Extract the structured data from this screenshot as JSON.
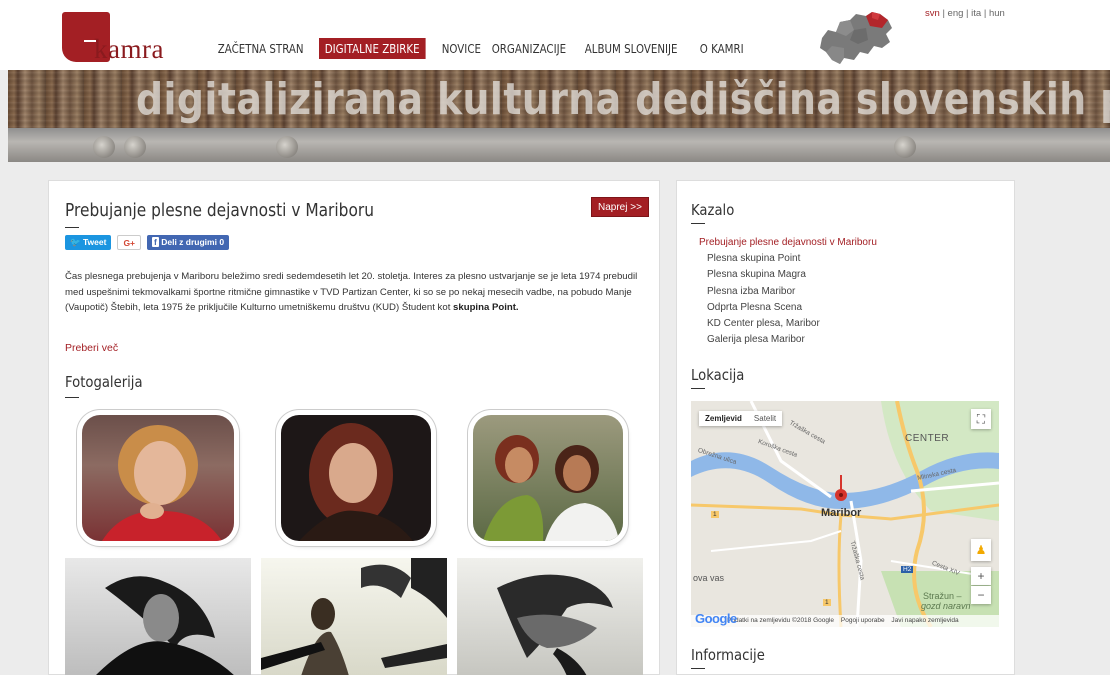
{
  "header": {
    "logo_text": "kamra",
    "nav": [
      {
        "label": "ZAČETNA STRAN",
        "active": false
      },
      {
        "label": "DIGITALNE ZBIRKE",
        "active": true
      },
      {
        "label": "NOVICE",
        "active": false
      },
      {
        "label": "ORGANIZACIJE",
        "active": false
      },
      {
        "label": "ALBUM SLOVENIJE",
        "active": false
      },
      {
        "label": "O KAMRI",
        "active": false
      }
    ],
    "languages": [
      "svn",
      "eng",
      "ita",
      "hun"
    ],
    "language_separator": "|",
    "selected_language": "svn"
  },
  "banner": {
    "title": "digitalizirana kulturna dediščina slovenskih pokrajin"
  },
  "article": {
    "title": "Prebujanje plesne dejavnosti v Mariboru",
    "next_label": "Naprej >>",
    "share": {
      "tweet": "Tweet",
      "gplus": "G+",
      "facebook": "Deli z drugimi",
      "facebook_count": "0"
    },
    "intro_text": "Čas plesnega prebujenja v Mariboru beležimo sredi sedemdesetih let 20. stoletja. Interes za plesno ustvarjanje se je leta 1974 prebudil med uspešnimi tekmovalkami športne ritmične gimnastike v TVD Partizan Center, ki so se po nekaj mesecih vadbe, na pobudo Manje (Vaupotič) Štebih, leta 1975 že priključile Kulturno umetniškemu društvu (KUD) Študent kot",
    "intro_bold": "skupina Point.",
    "read_more": "Preberi več",
    "gallery_title": "Fotogalerija"
  },
  "sidebar": {
    "toc_title": "Kazalo",
    "toc": [
      {
        "label": "Prebujanje plesne dejavnosti v Mariboru",
        "active": true
      },
      {
        "label": "Plesna skupina Point",
        "active": false
      },
      {
        "label": "Plesna skupina Magra",
        "active": false
      },
      {
        "label": "Plesna izba Maribor",
        "active": false
      },
      {
        "label": "Odprta Plesna Scena",
        "active": false
      },
      {
        "label": "KD Center plesa, Maribor",
        "active": false
      },
      {
        "label": "Galerija plesa Maribor",
        "active": false
      }
    ],
    "location_title": "Lokacija",
    "map": {
      "tab_map": "Zemljevid",
      "tab_satellite": "Satelit",
      "city_label": "Maribor",
      "district_label": "CENTER",
      "street_labels": [
        "Koroška cesta",
        "Obrežna ulica",
        "Tržaška cesta",
        "Mlinska cesta",
        "Tržaška cesta",
        "Cesta XIV"
      ],
      "area_labels": [
        "ova vas",
        "Stražun –",
        "gozd naravn"
      ],
      "road_badges": [
        "H2",
        "1",
        "1"
      ],
      "google_logo": "Google",
      "footer_data": "Podatki na zemljevidu ©2018 Google",
      "footer_terms": "Pogoji uporabe",
      "footer_report": "Javi napako zemljevida"
    },
    "info_title": "Informacije"
  },
  "colors": {
    "accent": "#a31f24",
    "background": "#ececec",
    "panel": "#ffffff"
  }
}
